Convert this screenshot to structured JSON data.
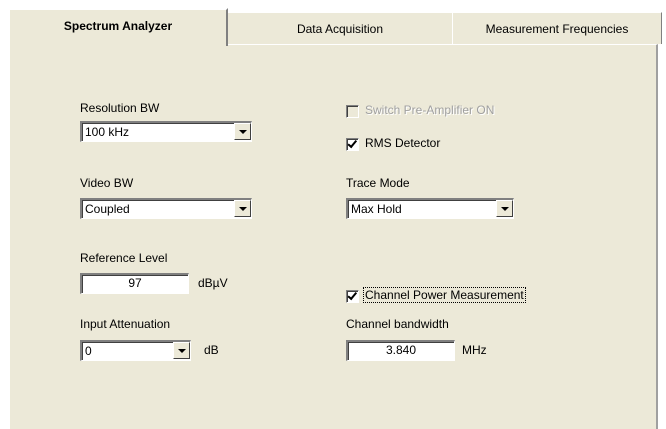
{
  "tabs": [
    {
      "label": "Spectrum Analyzer",
      "active": true
    },
    {
      "label": "Data Acquisition",
      "active": false
    },
    {
      "label": "Measurement Frequencies",
      "active": false
    }
  ],
  "resolution_bw": {
    "label": "Resolution BW",
    "value": "100 kHz"
  },
  "video_bw": {
    "label": "Video BW",
    "value": "Coupled"
  },
  "reference_level": {
    "label": "Reference Level",
    "value": "97",
    "unit": "dBµV"
  },
  "input_attenuation": {
    "label": "Input Attenuation",
    "value": "0",
    "unit": "dB"
  },
  "preamp": {
    "label": "Switch Pre-Amplifier ON",
    "checked": false,
    "enabled": false
  },
  "rms_detector": {
    "label": "RMS Detector",
    "checked": true
  },
  "trace_mode": {
    "label": "Trace Mode",
    "value": "Max Hold"
  },
  "channel_power": {
    "label": "Channel Power Measurement",
    "checked": true
  },
  "channel_bandwidth": {
    "label": "Channel bandwidth",
    "value": "3.840",
    "unit": "MHz"
  },
  "colors": {
    "panel": "#ece9d8",
    "disabled_text": "#a0a0a0"
  }
}
